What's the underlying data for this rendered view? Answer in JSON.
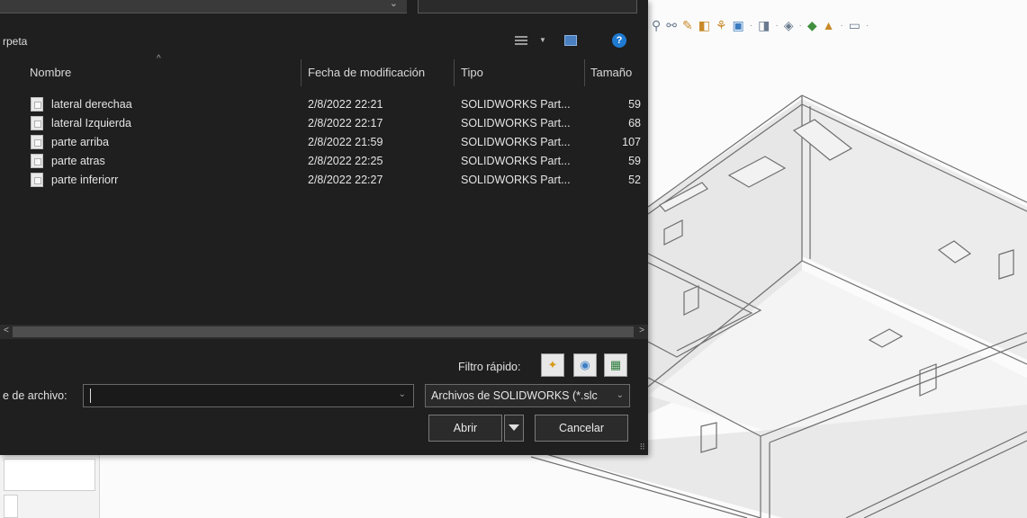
{
  "dialog": {
    "folder_label": "rpeta",
    "columns": {
      "name": "Nombre",
      "date": "Fecha de modificación",
      "type": "Tipo",
      "size": "Tamaño"
    },
    "files": [
      {
        "name": "lateral derechaa",
        "date": "2/8/2022 22:21",
        "type": "SOLIDWORKS Part...",
        "size": "59"
      },
      {
        "name": "lateral Izquierda",
        "date": "2/8/2022 22:17",
        "type": "SOLIDWORKS Part...",
        "size": "68"
      },
      {
        "name": "parte arriba",
        "date": "2/8/2022 21:59",
        "type": "SOLIDWORKS Part...",
        "size": "107"
      },
      {
        "name": "parte atras",
        "date": "2/8/2022 22:25",
        "type": "SOLIDWORKS Part...",
        "size": "59"
      },
      {
        "name": "parte inferiorr",
        "date": "2/8/2022 22:27",
        "type": "SOLIDWORKS Part...",
        "size": "52"
      }
    ],
    "quick_filter_label": "Filtro rápido:",
    "filename_label": "e de archivo:",
    "filename_value": "",
    "file_type_value": "Archivos de SOLIDWORKS (*.slc",
    "open_button": "Abrir",
    "cancel_button": "Cancelar",
    "help_glyph": "?"
  },
  "icons": {
    "view": "view-options-icon",
    "preview_pane": "preview-pane-icon",
    "help": "help-icon",
    "file": "solidworks-part-file-icon",
    "filter1": "filter-parts-icon",
    "filter2": "filter-assemblies-icon",
    "filter3": "filter-drawings-icon"
  },
  "colors": {
    "dialog_bg": "#1f1f1f",
    "help_blue": "#1f7ad1",
    "viewport_bg": "#fbfbfb"
  }
}
